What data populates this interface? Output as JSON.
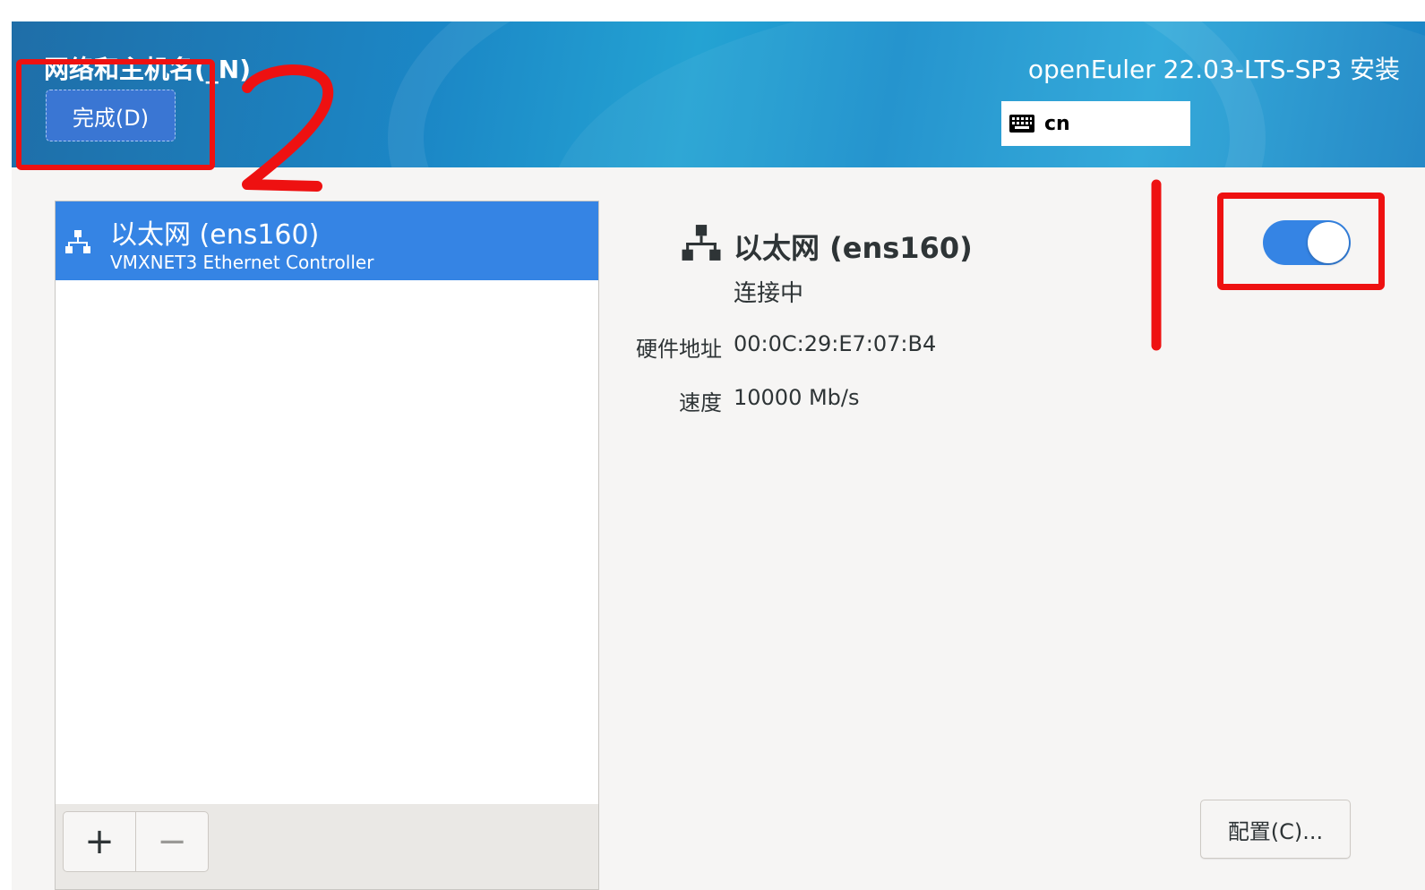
{
  "header": {
    "spoke_title": "网络和主机名(_N)",
    "done_button": "完成(D)",
    "product_title": "openEuler 22.03-LTS-SP3 安装",
    "keyboard_layout": "cn"
  },
  "device_list": {
    "devices": [
      {
        "name": "以太网 (ens160)",
        "description": "VMXNET3 Ethernet Controller",
        "selected": true
      }
    ],
    "add_button": "+",
    "remove_button": "−"
  },
  "detail": {
    "device_name": "以太网 (ens160)",
    "status": "连接中",
    "hardware_address_label": "硬件地址",
    "hardware_address": "00:0C:29:E7:07:B4",
    "speed_label": "速度",
    "speed": "10000 Mb/s",
    "switch_on": true,
    "configure_button": "配置(C)..."
  },
  "annotations": {
    "step_number": "2",
    "color": "#ee1111"
  },
  "colors": {
    "accent": "#3584e4",
    "header_blue": "#1b87c6",
    "annotation_red": "#ee1111"
  }
}
